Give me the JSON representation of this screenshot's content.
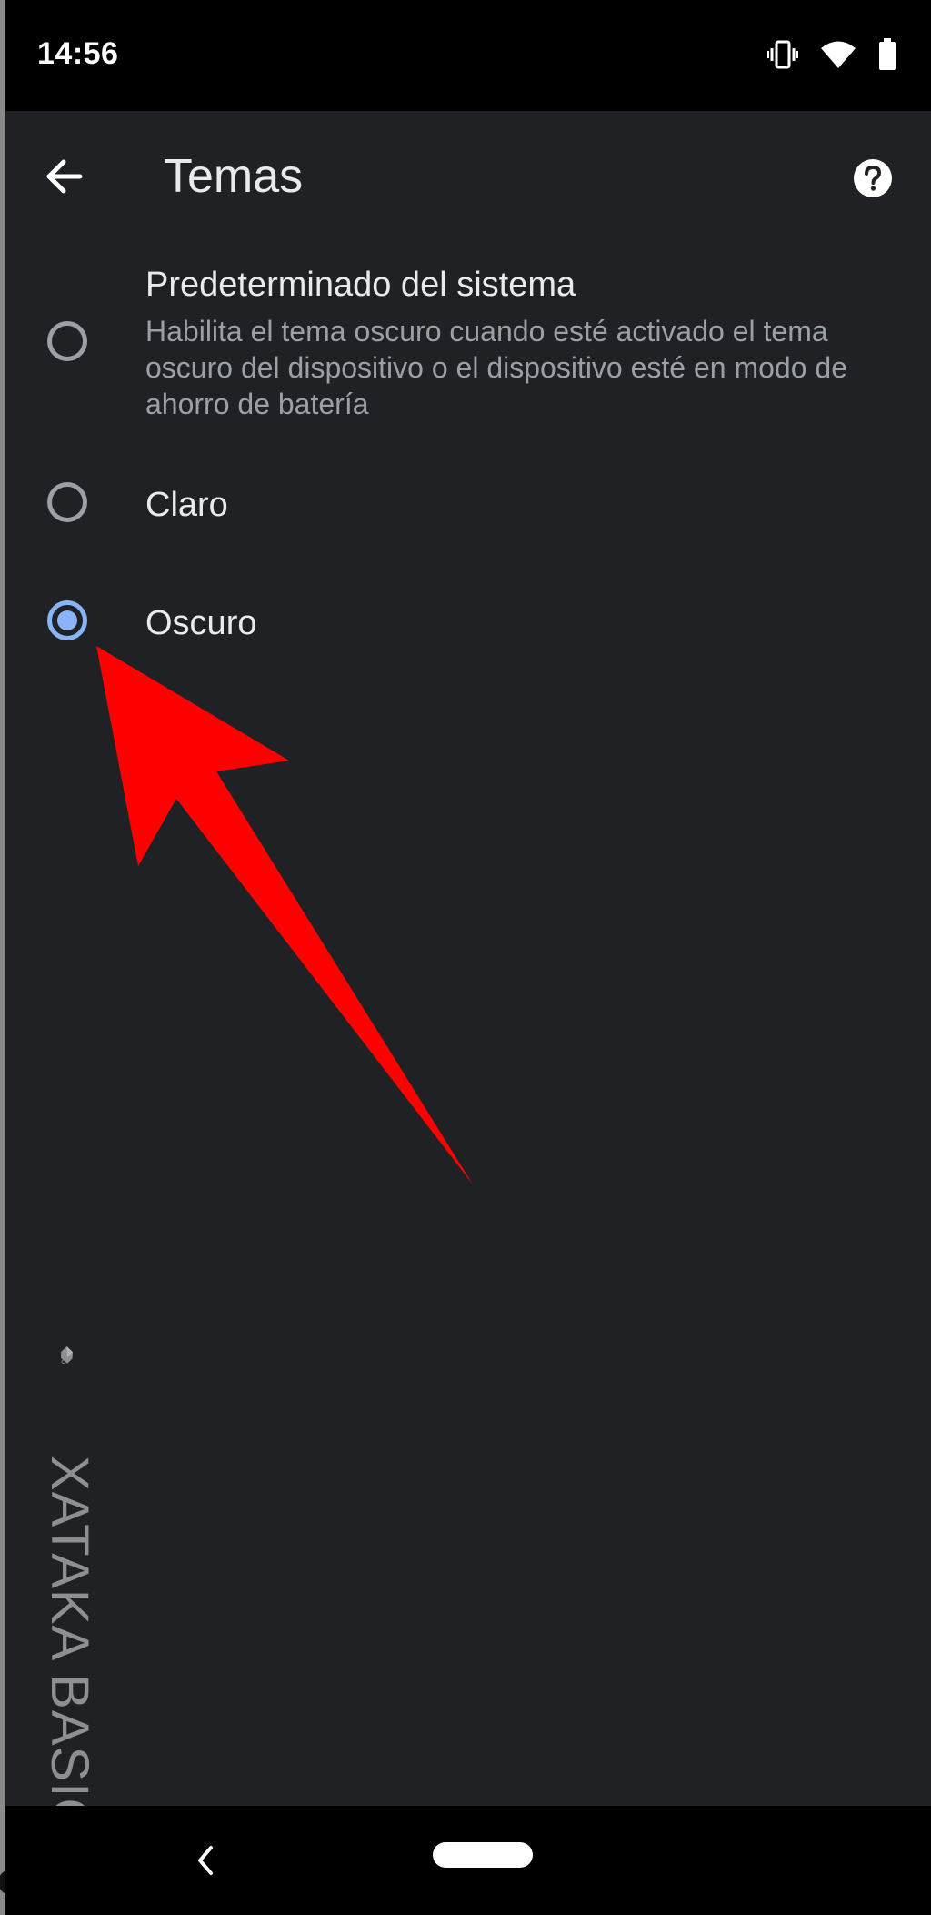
{
  "status_bar": {
    "time": "14:56",
    "icons": [
      "vibrate-icon",
      "wifi-icon",
      "battery-icon"
    ]
  },
  "app_bar": {
    "title": "Temas",
    "back_icon": "arrow-back-icon",
    "help_icon": "help-icon"
  },
  "options": [
    {
      "title": "Predeterminado del sistema",
      "description": "Habilita el tema oscuro cuando esté activado el tema oscuro del dispositivo o el dispositivo esté en modo de ahorro de batería",
      "checked": false
    },
    {
      "title": "Claro",
      "checked": false
    },
    {
      "title": "Oscuro",
      "checked": true
    }
  ],
  "watermark": {
    "text": "XATAKA BASICS"
  },
  "colors": {
    "background": "#202124",
    "primary_text": "#e8eaed",
    "secondary_text": "#9aa0a6",
    "accent": "#8ab4f8",
    "annotation_arrow": "#ff0000"
  }
}
